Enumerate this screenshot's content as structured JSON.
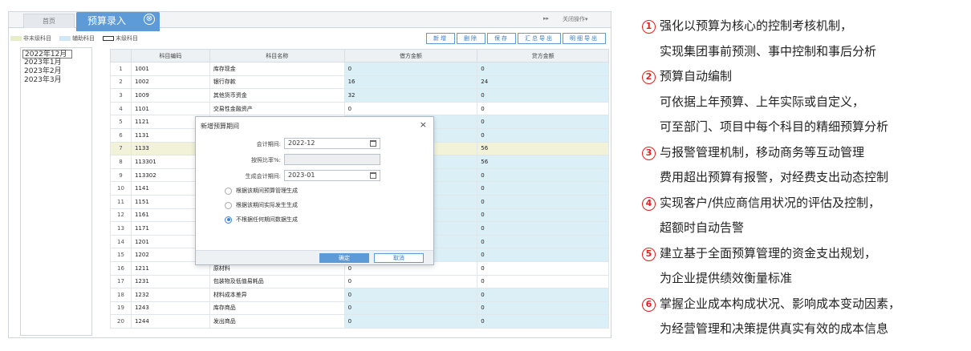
{
  "tabs": {
    "home": "首页",
    "active": "预算录入",
    "close_glyph": "⊗",
    "scroll_glyph": "▸▸",
    "close_ops": "关闭操作▾"
  },
  "legend": [
    {
      "label": "非末级科目",
      "color": "#e4efc8"
    },
    {
      "label": "辅助科目",
      "color": "#cfe8f4"
    },
    {
      "label": "末级科目",
      "color": "#ffffff"
    }
  ],
  "toolbar": [
    "新增",
    "删除",
    "保存",
    "汇总导出",
    "明细导出"
  ],
  "periods": [
    "2022年12月",
    "2023年1月",
    "2023年2月",
    "2023年3月"
  ],
  "grid": {
    "headers": [
      "",
      "科目编码",
      "科目名称",
      "借方金额",
      "贷方金额"
    ],
    "rows": [
      {
        "n": "1",
        "code": "1001",
        "name": "库存现金",
        "debit": "0",
        "credit": "0"
      },
      {
        "n": "2",
        "code": "1002",
        "name": "银行存款",
        "debit": "16",
        "credit": "24"
      },
      {
        "n": "3",
        "code": "1009",
        "name": "其他货币资金",
        "debit": "32",
        "credit": "0"
      },
      {
        "n": "4",
        "code": "1101",
        "name": "交易性金融资产",
        "debit": "0",
        "credit": "0"
      },
      {
        "n": "5",
        "code": "1121",
        "name": "",
        "debit": "",
        "credit": "0"
      },
      {
        "n": "6",
        "code": "1131",
        "name": "",
        "debit": "",
        "credit": "0"
      },
      {
        "n": "7",
        "code": "1133",
        "name": "",
        "debit": "",
        "credit": "56"
      },
      {
        "n": "8",
        "code": "113301",
        "name": "",
        "debit": "",
        "credit": "56"
      },
      {
        "n": "9",
        "code": "113302",
        "name": "",
        "debit": "",
        "credit": "0"
      },
      {
        "n": "10",
        "code": "1141",
        "name": "",
        "debit": "",
        "credit": "0"
      },
      {
        "n": "11",
        "code": "1151",
        "name": "",
        "debit": "",
        "credit": "0"
      },
      {
        "n": "12",
        "code": "1161",
        "name": "",
        "debit": "",
        "credit": "0"
      },
      {
        "n": "13",
        "code": "1171",
        "name": "",
        "debit": "",
        "credit": "0"
      },
      {
        "n": "14",
        "code": "1201",
        "name": "",
        "debit": "",
        "credit": "0"
      },
      {
        "n": "15",
        "code": "1202",
        "name": "",
        "debit": "",
        "credit": "0"
      },
      {
        "n": "16",
        "code": "1211",
        "name": "原材料",
        "debit": "0",
        "credit": "0"
      },
      {
        "n": "17",
        "code": "1231",
        "name": "包装物及低值易耗品",
        "debit": "0",
        "credit": "0"
      },
      {
        "n": "18",
        "code": "1232",
        "name": "材料成本差异",
        "debit": "0",
        "credit": "0"
      },
      {
        "n": "19",
        "code": "1243",
        "name": "库存商品",
        "debit": "0",
        "credit": "0"
      },
      {
        "n": "20",
        "code": "1244",
        "name": "发出商品",
        "debit": "0",
        "credit": "0"
      }
    ]
  },
  "dialog": {
    "title": "新增预算期间",
    "close": "×",
    "period_label": "会计期间:",
    "period_value": "2022-12",
    "ratio_label": "按照比率%:",
    "ratio_value": "",
    "gen_label": "生成会计期间:",
    "gen_value": "2023-01",
    "radios": [
      {
        "label": "根据该期间预算管理生成",
        "checked": false
      },
      {
        "label": "根据该期间实际发生生成",
        "checked": false
      },
      {
        "label": "不根据任何期间数据生成",
        "checked": true
      }
    ],
    "ok": "确定",
    "cancel": "取消"
  },
  "features": [
    {
      "num": "1",
      "lines": [
        "强化以预算为核心的控制考核机制，",
        "实现集团事前预测、事中控制和事后分析"
      ]
    },
    {
      "num": "2",
      "lines": [
        "预算自动编制",
        "可依据上年预算、上年实际或自定义，",
        "可至部门、项目中每个科目的精细预算分析"
      ]
    },
    {
      "num": "3",
      "lines": [
        "与报警管理机制，移动商务等互动管理",
        "费用超出预算有报警，对经费支出动态控制"
      ]
    },
    {
      "num": "4",
      "lines": [
        "实现客户/供应商信用状况的评估及控制，",
        "超额时自动告警"
      ]
    },
    {
      "num": "5",
      "lines": [
        "建立基于全面预算管理的资金支出规划，",
        "为企业提供绩效衡量标准"
      ]
    },
    {
      "num": "6",
      "lines": [
        "掌握企业成本构成状况、影响成本变动因素，",
        "为经营管理和决策提供真实有效的成本信息"
      ]
    }
  ]
}
